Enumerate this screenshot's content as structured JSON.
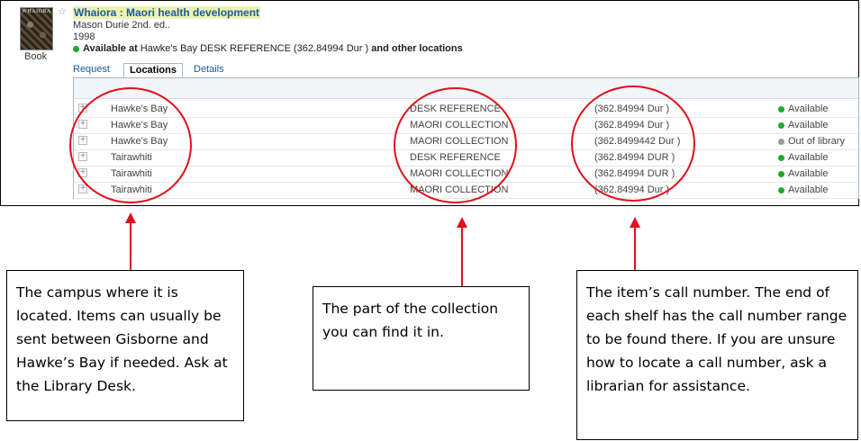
{
  "record": {
    "cover_text": "WHAIORA",
    "format_label": "Book",
    "star_glyph": "☆",
    "title": "Whaiora : Maori health development",
    "author_edition": "Mason Durie 2nd. ed..",
    "year": "1998",
    "availability_prefix": "Available at",
    "availability_location": "Hawke's Bay DESK REFERENCE (362.84994 Dur )",
    "availability_suffix": "and other locations"
  },
  "tabs": [
    {
      "label": "Request"
    },
    {
      "label": "Locations"
    },
    {
      "label": "Details"
    }
  ],
  "locations": {
    "rows": [
      {
        "campus": "Hawke's Bay",
        "collection": "DESK REFERENCE",
        "call_number": "(362.84994 Dur )",
        "status": "Available",
        "status_color": "#1eaa2a"
      },
      {
        "campus": "Hawke's Bay",
        "collection": "MAORI COLLECTION",
        "call_number": "(362.84994 Dur )",
        "status": "Available",
        "status_color": "#1eaa2a"
      },
      {
        "campus": "Hawke's Bay",
        "collection": "MAORI COLLECTION",
        "call_number": "(362.8499442 Dur )",
        "status": "Out of library",
        "status_color": "#999999"
      },
      {
        "campus": "Tairawhiti",
        "collection": "DESK REFERENCE",
        "call_number": "(362.84994 DUR )",
        "status": "Available",
        "status_color": "#1eaa2a"
      },
      {
        "campus": "Tairawhiti",
        "collection": "MAORI COLLECTION",
        "call_number": "(362.84994 DUR )",
        "status": "Available",
        "status_color": "#1eaa2a"
      },
      {
        "campus": "Tairawhiti",
        "collection": "MAORI COLLECTION",
        "call_number": "(362.84994 Dur )",
        "status": "Available",
        "status_color": "#1eaa2a"
      }
    ]
  },
  "annotations": {
    "campus_note": "The campus where it is located. Items can usually be sent between Gisborne and Hawke’s Bay if needed. Ask at the Library Desk.",
    "collection_note": "The part of the collection you can find it in.",
    "call_number_note": "The item’s call number. The end of each shelf has the call number range to be found there. If you are unsure how to locate a call number, ask a librarian for assistance.",
    "highlight_color": "#e0101a"
  }
}
